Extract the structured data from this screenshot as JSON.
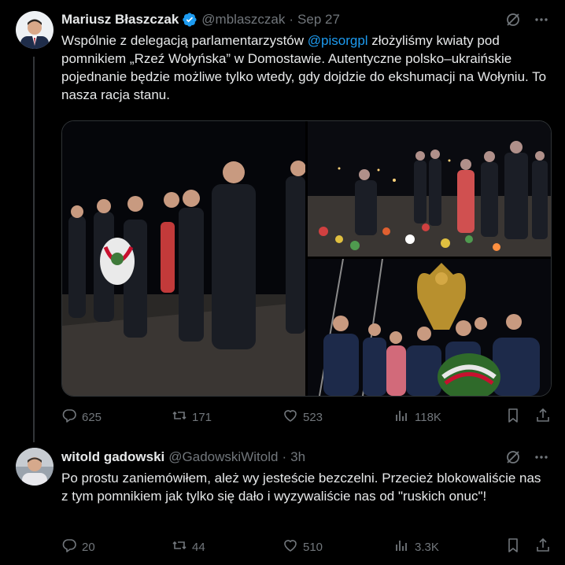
{
  "tweets": [
    {
      "name": "Mariusz Błaszczak",
      "handle": "@mblaszczak",
      "separator": "·",
      "date": "Sep 27",
      "text_before": "Wspólnie z delegacją parlamentarzystów ",
      "mention": "@pisorgpl",
      "text_after": " złożyliśmy kwiaty pod pomnikiem „Rzeź Wołyńska” w Domostawie. Autentyczne polsko–ukraińskie pojednanie będzie możliwe tylko wtedy, gdy dojdzie do ekshumacji na Wołyniu. To nasza racja stanu.",
      "stats": {
        "replies": "625",
        "reposts": "171",
        "likes": "523",
        "views": "118K"
      }
    },
    {
      "name": "witold gadowski",
      "handle": "@GadowskiWitold",
      "separator": "·",
      "date": "3h",
      "text": "Po prostu zaniemówiłem, ależ wy jesteście bezczelni. Przecież blokowaliście nas z tym pomnikiem jak tylko się dało i wyzywaliście nas od \"ruskich onuc\"!",
      "stats": {
        "replies": "20",
        "reposts": "44",
        "likes": "510",
        "views": "3.3K"
      }
    }
  ],
  "colors": {
    "accent": "#1d9bf0",
    "muted": "#71767b",
    "text": "#e7e9ea",
    "background": "#000000"
  },
  "icons": [
    "verified-badge-icon",
    "grok-icon",
    "more-icon",
    "reply-icon",
    "repost-icon",
    "like-icon",
    "views-icon",
    "bookmark-icon",
    "share-icon"
  ]
}
